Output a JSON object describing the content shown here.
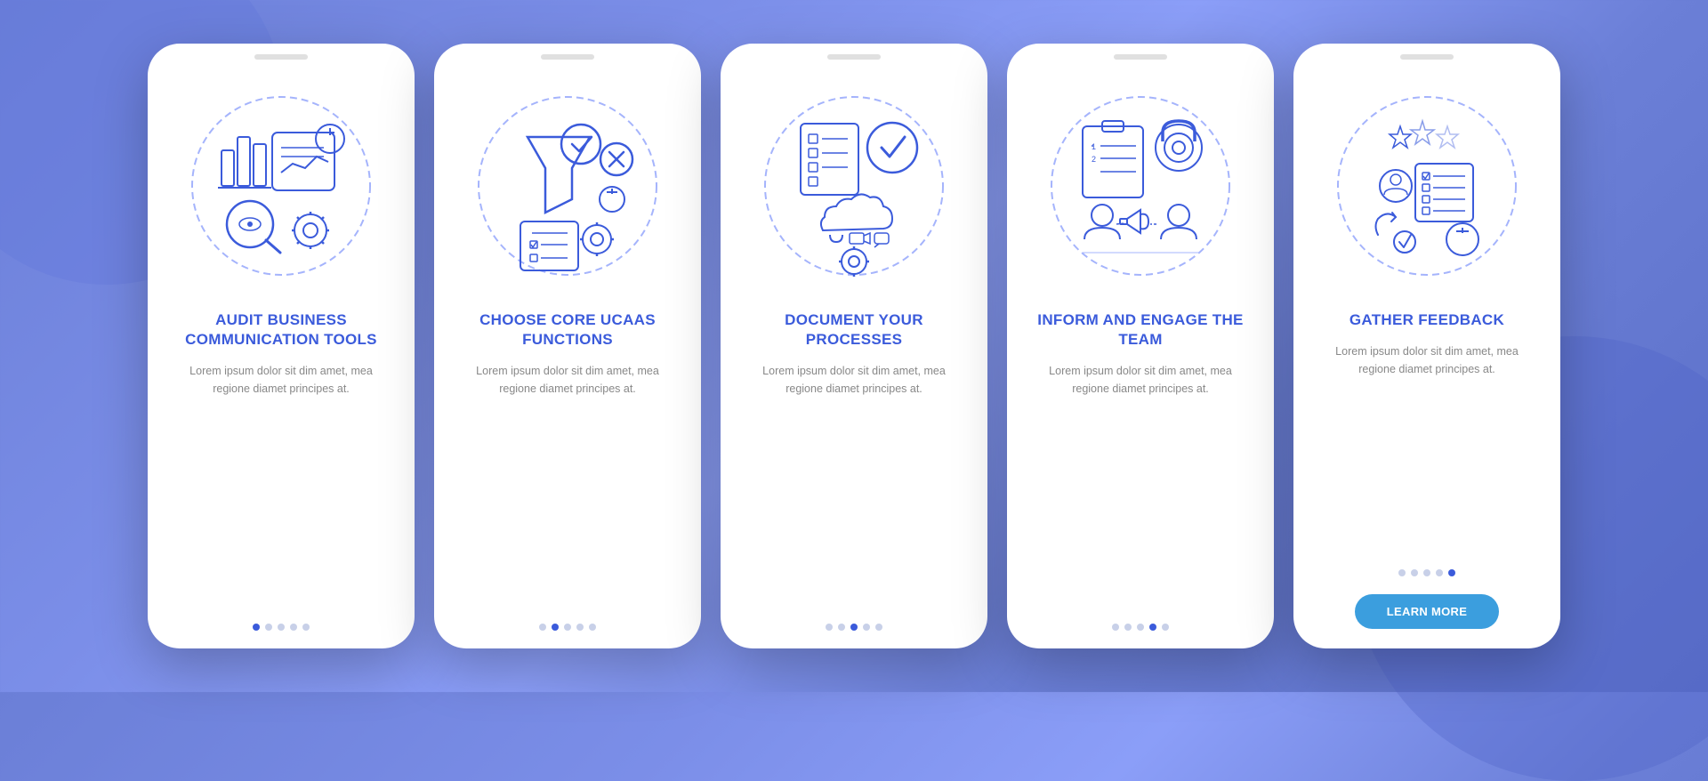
{
  "background": {
    "gradient_start": "#6b7fd7",
    "gradient_end": "#5a6ec6"
  },
  "cards": [
    {
      "id": "card-1",
      "title": "AUDIT BUSINESS COMMUNICATION TOOLS",
      "description": "Lorem ipsum dolor sit dim amet, mea regione diamet principes at.",
      "dots": [
        "active",
        "inactive",
        "inactive",
        "inactive",
        "inactive"
      ],
      "show_button": false,
      "button_label": ""
    },
    {
      "id": "card-2",
      "title": "CHOOSE CORE UCAAS FUNCTIONS",
      "description": "Lorem ipsum dolor sit dim amet, mea regione diamet principes at.",
      "dots": [
        "inactive",
        "active",
        "inactive",
        "inactive",
        "inactive"
      ],
      "show_button": false,
      "button_label": ""
    },
    {
      "id": "card-3",
      "title": "DOCUMENT YOUR PROCESSES",
      "description": "Lorem ipsum dolor sit dim amet, mea regione diamet principes at.",
      "dots": [
        "inactive",
        "inactive",
        "active",
        "inactive",
        "inactive"
      ],
      "show_button": false,
      "button_label": ""
    },
    {
      "id": "card-4",
      "title": "INFORM AND ENGAGE THE TEAM",
      "description": "Lorem ipsum dolor sit dim amet, mea regione diamet principes at.",
      "dots": [
        "inactive",
        "inactive",
        "inactive",
        "active",
        "inactive"
      ],
      "show_button": false,
      "button_label": ""
    },
    {
      "id": "card-5",
      "title": "GATHER FEEDBACK",
      "description": "Lorem ipsum dolor sit dim amet, mea regione diamet principes at.",
      "dots": [
        "inactive",
        "inactive",
        "inactive",
        "inactive",
        "active"
      ],
      "show_button": true,
      "button_label": "LEARN MORE"
    }
  ]
}
